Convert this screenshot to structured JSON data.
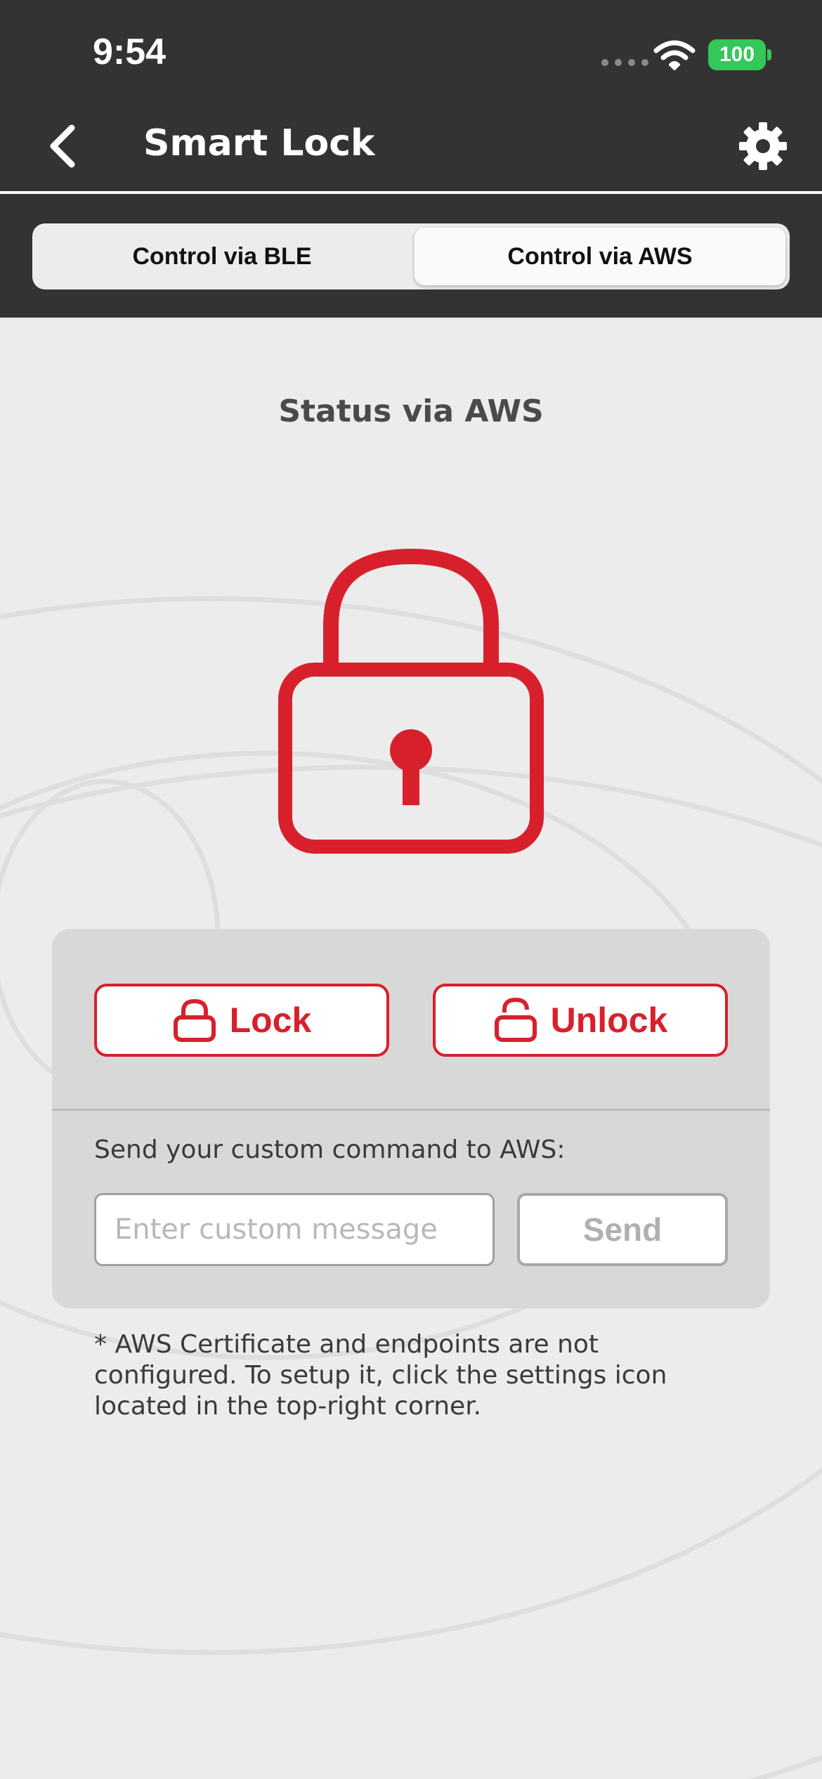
{
  "status_bar": {
    "time": "9:54",
    "battery": "100",
    "battery_color": "#34c759"
  },
  "nav": {
    "title": "Smart Lock",
    "back_icon": "chevron-left-icon",
    "settings_icon": "gear-icon"
  },
  "segments": {
    "ble_label": "Control via BLE",
    "aws_label": "Control via AWS",
    "selected": "aws"
  },
  "status": {
    "title": "Status via AWS",
    "lock_state_icon": "padlock-locked-icon"
  },
  "actions": {
    "lock_label": "Lock",
    "unlock_label": "Unlock"
  },
  "custom_command": {
    "label": "Send your custom command to AWS:",
    "placeholder": "Enter custom message",
    "value": "",
    "send_label": "Send"
  },
  "note": "* AWS Certificate and endpoints are not configured. To setup it, click the settings icon located in the top-right corner.",
  "colors": {
    "accent": "#d8202c",
    "header_bg": "#333333",
    "page_bg": "#ececec",
    "card_bg": "#d8d8d8"
  }
}
